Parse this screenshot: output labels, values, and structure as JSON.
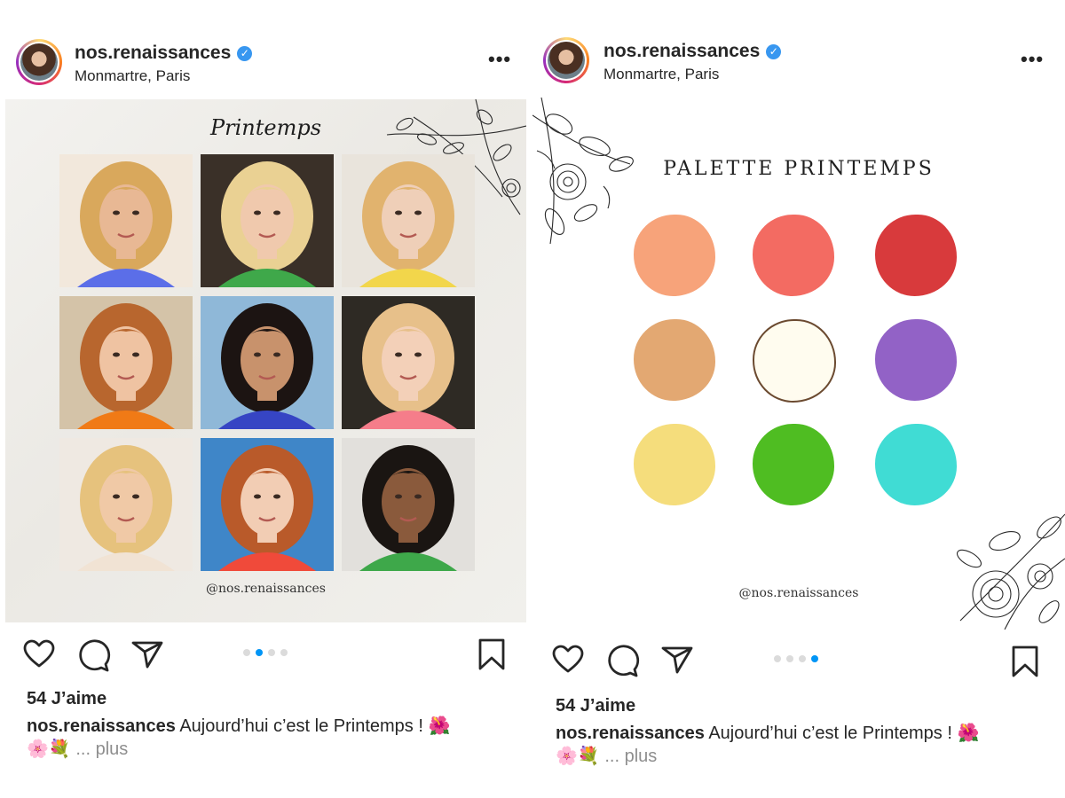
{
  "posts": [
    {
      "username": "nos.renaissances",
      "location": "Monmartre, Paris",
      "media_title": "Printemps",
      "handle_tag": "@nos.renaissances",
      "likes": "54 J’aime",
      "caption_user": "nos.renaissances",
      "caption_text": " Aujourd’hui c’est le Printemps ! 🌺",
      "caption_line2": "🌸💐",
      "caption_more": "... plus",
      "carousel_index": 2,
      "carousel_total": 4
    },
    {
      "username": "nos.renaissances",
      "location": "Monmartre, Paris",
      "media_title": "PALETTE PRINTEMPS",
      "handle_tag": "@nos.renaissances",
      "likes": "54 J’aime",
      "caption_user": "nos.renaissances",
      "caption_text": " Aujourd’hui c’est le Printemps ! 🌺",
      "caption_line2": "🌸💐",
      "caption_more": "... plus",
      "carousel_index": 4,
      "carousel_total": 4
    }
  ],
  "portraits": [
    {
      "hair": "#d9a85c",
      "skin": "#e8b894",
      "clothes": "#5b6ee8",
      "bg": "#f2e8dc"
    },
    {
      "hair": "#ead193",
      "skin": "#f0c9ad",
      "clothes": "#3fa84a",
      "bg": "#3a3028"
    },
    {
      "hair": "#e1b36e",
      "skin": "#efcfb8",
      "clothes": "#f2d64b",
      "bg": "#e9e4dc"
    },
    {
      "hair": "#b8662e",
      "skin": "#efc3a2",
      "clothes": "#f07a16",
      "bg": "#d4c3a8"
    },
    {
      "hair": "#1c1412",
      "skin": "#c8926c",
      "clothes": "#3645c4",
      "bg": "#8fb8d8"
    },
    {
      "hair": "#e7c08a",
      "skin": "#f3d0b8",
      "clothes": "#f57d8a",
      "bg": "#2e2a24"
    },
    {
      "hair": "#e6c27d",
      "skin": "#f0c9a6",
      "clothes": "#f1e3d4",
      "bg": "#efe9e2"
    },
    {
      "hair": "#b95a2a",
      "skin": "#f2cdb4",
      "clothes": "#f04a3a",
      "bg": "#3f86c8"
    },
    {
      "hair": "#1a1512",
      "skin": "#8a5a3c",
      "clothes": "#3ea84a",
      "bg": "#e2e0dc"
    }
  ],
  "palette_colors": [
    "#f7a37a",
    "#f36b62",
    "#d83a3c",
    "#e3a872",
    "#fffcef",
    "#9262c6",
    "#f5dd7c",
    "#4fbd22",
    "#40dcd4"
  ],
  "accent_colors": {
    "verified": "#3897f0",
    "dot_active": "#0095f6",
    "dot_inactive": "#dbdbdb"
  }
}
